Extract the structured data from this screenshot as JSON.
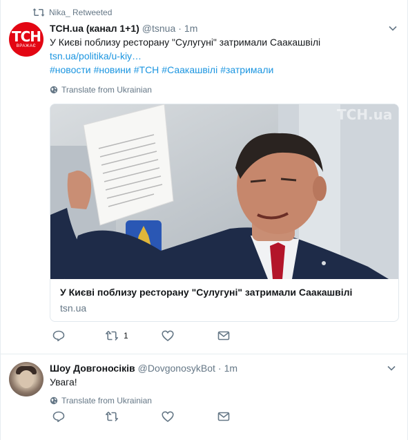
{
  "colors": {
    "link": "#1b95e0",
    "muted": "#657786",
    "text": "#14171a",
    "avatar_tsn": "#e30613"
  },
  "retweet_line": {
    "label": "Nika_ Retweeted",
    "icon": "retweet-icon"
  },
  "tweet1": {
    "avatar": {
      "logo": "ТСН",
      "sub": "ВРАЖАЄ"
    },
    "name": "ТСН.ua (канал 1+1)",
    "handle": "@tsnua",
    "dot": "·",
    "time": "1m",
    "text": "У Києві поблизу ресторану \"Сулугуні\" затримали Саакашвілі",
    "link": "tsn.ua/politika/u-kiy…",
    "hashtags": [
      "#новости",
      "#новини",
      "#ТСН",
      "#Саакашвілі",
      "#затримали"
    ],
    "translate": "Translate from Ukrainian",
    "card": {
      "title": "У Києві поблизу ресторану \"Сулугуні\" затримали Саакашвілі",
      "domain": "tsn.ua",
      "watermark": "ТСН.ua"
    },
    "actions": {
      "reply": "",
      "retweet_count": "1",
      "like": "",
      "dm": ""
    }
  },
  "tweet2": {
    "name": "Шоу Довгоносіків",
    "handle": "@DovgonosykBot",
    "dot": "·",
    "time": "1m",
    "text": "Увага!",
    "translate": "Translate from Ukrainian"
  }
}
